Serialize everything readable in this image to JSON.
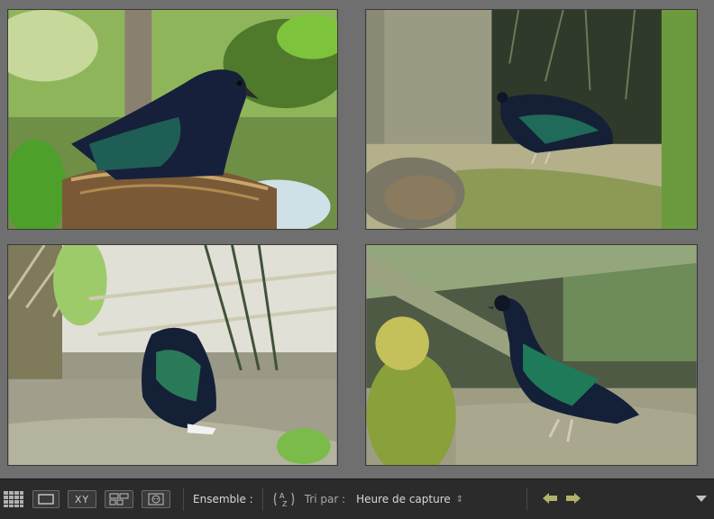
{
  "toolbar": {
    "view_buttons": [
      {
        "name": "grid-view-button",
        "icon": "grid-icon"
      },
      {
        "name": "loupe-view-button",
        "icon": "loupe-icon"
      },
      {
        "name": "compare-view-button",
        "icon": "compare-xy-icon",
        "text": "XY"
      },
      {
        "name": "survey-view-button",
        "icon": "survey-icon"
      },
      {
        "name": "people-view-button",
        "icon": "face-icon"
      }
    ],
    "ensemble_label": "Ensemble :",
    "sort_label": "Tri par :",
    "sort_value": "Heure de capture",
    "sort_caret": "⇕",
    "prev_icon": "arrow-left-icon",
    "next_icon": "arrow-right-icon",
    "menu_icon": "triangle-down-icon"
  },
  "colors": {
    "background": "#6f6f6f",
    "toolbar": "#2b2b2b",
    "arrow_accent": "#b2b26a"
  }
}
